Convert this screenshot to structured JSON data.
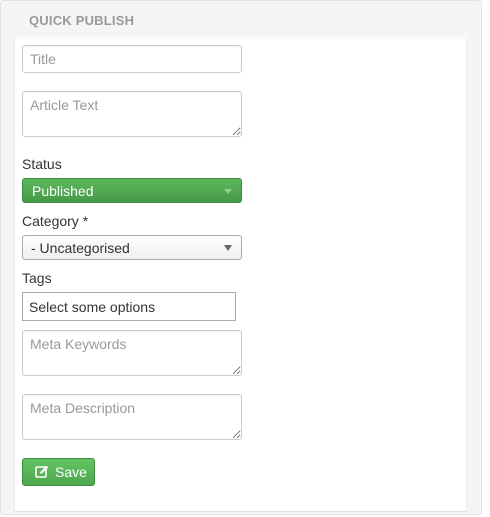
{
  "panel": {
    "title": "QUICK PUBLISH"
  },
  "form": {
    "title_placeholder": "Title",
    "article_text_placeholder": "Article Text",
    "status_label": "Status",
    "status_value": "Published",
    "category_label": "Category *",
    "category_value": "- Uncategorised",
    "tags_label": "Tags",
    "tags_placeholder": "Select some options",
    "meta_keywords_placeholder": "Meta Keywords",
    "meta_description_placeholder": "Meta Description",
    "save_label": "Save"
  },
  "icons": {
    "save": "edit-icon"
  },
  "colors": {
    "success_green": "#5cb85c",
    "title_gray": "#999999"
  }
}
